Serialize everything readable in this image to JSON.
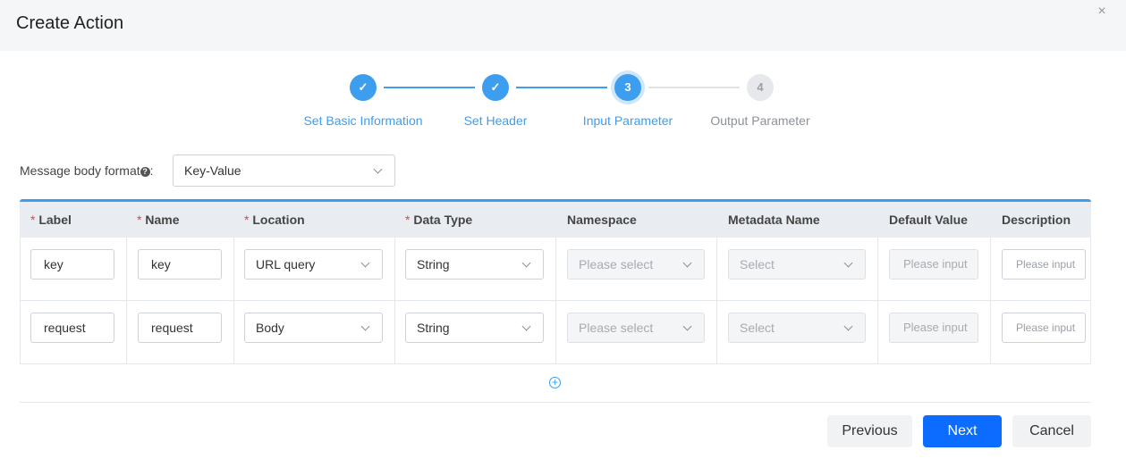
{
  "dialog": {
    "title": "Create Action",
    "close_symbol": "×"
  },
  "steps": [
    {
      "label": "Set Basic Information",
      "state": "done",
      "marker": "✓"
    },
    {
      "label": "Set Header",
      "state": "done",
      "marker": "✓"
    },
    {
      "label": "Input Parameter",
      "state": "active",
      "marker": "3"
    },
    {
      "label": "Output Parameter",
      "state": "todo",
      "marker": "4"
    }
  ],
  "message_format": {
    "label": "Message body format",
    "help": "?",
    "colon": ":",
    "value": "Key-Value"
  },
  "table": {
    "required_mark": "*",
    "columns": [
      {
        "label": "Label",
        "required": true
      },
      {
        "label": "Name",
        "required": true
      },
      {
        "label": "Location",
        "required": true
      },
      {
        "label": "Data Type",
        "required": true
      },
      {
        "label": "Namespace",
        "required": false
      },
      {
        "label": "Metadata Name",
        "required": false
      },
      {
        "label": "Default Value",
        "required": false
      },
      {
        "label": "Description",
        "required": false
      }
    ],
    "rows": [
      {
        "label": "key",
        "name": "key",
        "location": "URL query",
        "data_type": "String",
        "namespace_placeholder": "Please select",
        "metadata_placeholder": "Select",
        "default_placeholder": "Please input",
        "description_placeholder": "Please input"
      },
      {
        "label": "request",
        "name": "request",
        "location": "Body",
        "data_type": "String",
        "namespace_placeholder": "Please select",
        "metadata_placeholder": "Select",
        "default_placeholder": "Please input",
        "description_placeholder": "Please input"
      }
    ]
  },
  "add_row": {
    "symbol": "+"
  },
  "buttons": {
    "previous": "Previous",
    "next": "Next",
    "cancel": "Cancel"
  },
  "colors": {
    "accent": "#3d9ef0",
    "primary_button": "#0b6cff",
    "required": "#e6463c"
  }
}
